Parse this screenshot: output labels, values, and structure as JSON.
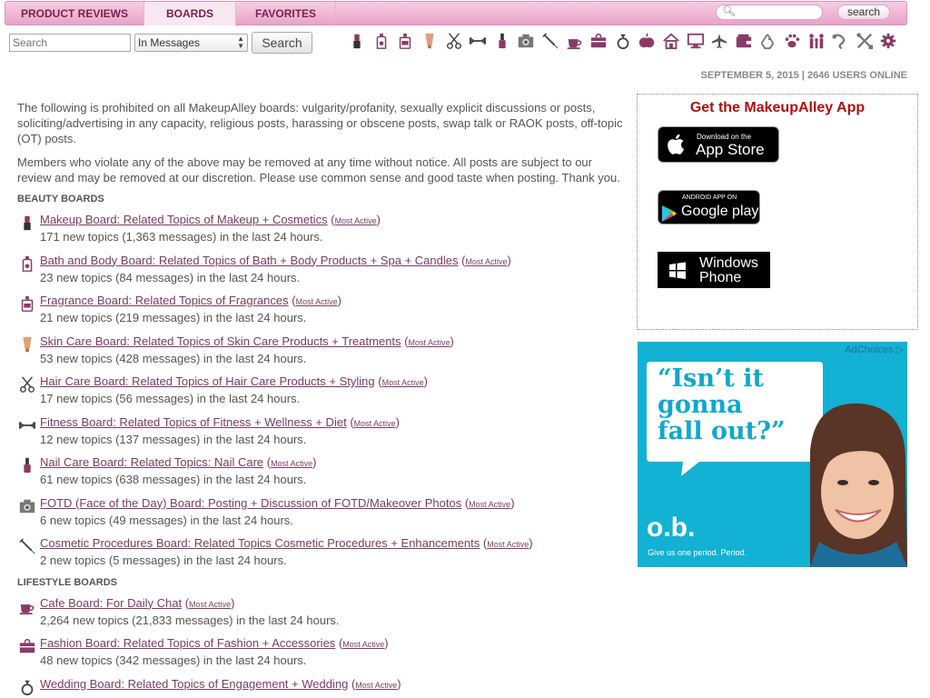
{
  "tabs": {
    "reviews": "PRODUCT REVIEWS",
    "boards": "BOARDS",
    "favorites": "FAVORITES"
  },
  "top_search": {
    "placeholder": "",
    "button_label": "search"
  },
  "board_search": {
    "placeholder": "Search",
    "scope_selected": "In Messages",
    "button_label": "Search"
  },
  "nav_icons": [
    "lipstick-icon",
    "bath-bottle-icon",
    "perfume-icon",
    "skincare-tube-icon",
    "scissors-icon",
    "dumbbell-icon",
    "nail-polish-icon",
    "camera-icon",
    "syringe-icon",
    "coffee-cup-icon",
    "handbag-icon",
    "ring-icon",
    "apple-icon",
    "house-icon",
    "monitor-icon",
    "airplane-icon",
    "wallet-icon",
    "recycle-icon",
    "paw-icon",
    "family-icon",
    "snake-icon",
    "tools-icon",
    "gear-icon"
  ],
  "status": {
    "date_line": "SEPTEMBER 5, 2015 | 2646 USERS ONLINE"
  },
  "intro": {
    "rules": "The following is prohibited on all MakeupAlley boards: vulgarity/profanity, sexually explicit discussions or posts, soliciting/advertising in any capacity, religious posts, harassing or obscene posts, swap talk or RAOK posts, off-topic (OT) posts.",
    "warning": "Members who violate any of the above may be removed at any time without notice. All posts are subject to our review and may be removed at our discretion. Please use common sense and good taste when posting. Thank you."
  },
  "most_active_label": "Most Active",
  "beauty_heading": "BEAUTY BOARDS",
  "beauty_boards": [
    {
      "icon": "lipstick-icon",
      "title": "Makeup Board: Related Topics of Makeup + Cosmetics",
      "stats": "171 new topics (1,363 messages) in the last 24 hours."
    },
    {
      "icon": "bath-bottle-icon",
      "title": "Bath and Body Board: Related Topics of Bath + Body Products + Spa + Candles",
      "stats": "23 new topics (84 messages) in the last 24 hours."
    },
    {
      "icon": "perfume-icon",
      "title": "Fragrance Board: Related Topics of Fragrances",
      "stats": "21 new topics (219 messages) in the last 24 hours."
    },
    {
      "icon": "skincare-tube-icon",
      "title": "Skin Care Board: Related Topics of Skin Care Products + Treatments",
      "stats": "53 new topics (428 messages) in the last 24 hours."
    },
    {
      "icon": "scissors-icon",
      "title": "Hair Care Board: Related Topics of Hair Care Products + Styling",
      "stats": "17 new topics (56 messages) in the last 24 hours."
    },
    {
      "icon": "dumbbell-icon",
      "title": "Fitness Board: Related Topics of Fitness + Wellness + Diet",
      "stats": "12 new topics (137 messages) in the last 24 hours."
    },
    {
      "icon": "nail-polish-icon",
      "title": "Nail Care Board: Related Topics: Nail Care",
      "stats": "61 new topics (638 messages) in the last 24 hours."
    },
    {
      "icon": "camera-icon",
      "title": "FOTD (Face of the Day) Board: Posting + Discussion of FOTD/Makeover Photos",
      "stats": "6 new topics (49 messages) in the last 24 hours."
    },
    {
      "icon": "syringe-icon",
      "title": "Cosmetic Procedures Board: Related Topics Cosmetic Procedures + Enhancements",
      "stats": "2 new topics (5 messages) in the last 24 hours."
    }
  ],
  "lifestyle_heading": "LIFESTYLE BOARDS",
  "lifestyle_boards": [
    {
      "icon": "coffee-cup-icon",
      "title": "Cafe Board: For Daily Chat",
      "stats": "2,264 new topics (21,833 messages) in the last 24 hours."
    },
    {
      "icon": "handbag-icon",
      "title": "Fashion Board: Related Topics of Fashion + Accessories",
      "stats": "48 new topics (342 messages) in the last 24 hours."
    },
    {
      "icon": "ring-icon",
      "title": "Wedding Board: Related Topics of Engagement + Wedding",
      "stats": ""
    }
  ],
  "app_box": {
    "title": "Get the MakeupAlley App",
    "apple_small": "Download on the",
    "apple_big": "App Store",
    "google_small": "ANDROID APP ON",
    "google_big": "Google play",
    "windows_line1": "Windows",
    "windows_line2": "Phone"
  },
  "ad": {
    "adchoices": "AdChoices",
    "quote_line1": "“Isn’t it",
    "quote_line2": "gonna",
    "quote_line3": "fall out?”",
    "logo": "o.b.",
    "tagline": "Give us one period. Period."
  },
  "colors": {
    "tab_bar": "#e8a3c9",
    "link": "#7b3b63",
    "icon": "#8a3a66",
    "app_title": "#b10e0e",
    "ad_bg": "#13b1d3"
  }
}
